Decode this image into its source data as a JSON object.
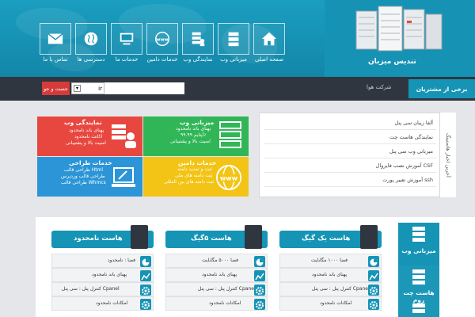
{
  "header": {
    "logo_text": "تندیس میزبان",
    "nav": [
      {
        "label": "صفحه اصلی",
        "icon": "home-icon"
      },
      {
        "label": "میزبانی وب",
        "icon": "server-icon"
      },
      {
        "label": "نمایندگی وب",
        "icon": "servers-user-icon"
      },
      {
        "label": "خدمات دامین",
        "icon": "www-globe-icon"
      },
      {
        "label": "خدمات ما",
        "icon": "monitor-icon"
      },
      {
        "label": "دسترسی ها",
        "icon": "globe-icon"
      },
      {
        "label": "تماس با ما",
        "icon": "mail-icon"
      }
    ]
  },
  "toolbar": {
    "login_label": "برخی از مشتریان",
    "company_label": "شرکت هوا",
    "search_placeholder": "",
    "domain_value": "ir",
    "search_button": "جست و جو"
  },
  "services": {
    "reseller": {
      "title": "نمایندگی وب",
      "lines": [
        "پهنای باند نامحدود",
        "اکانت نامحدود",
        "امنیت بالا و پشتیبانی"
      ]
    },
    "hosting": {
      "title": "میزبانی وب",
      "lines": [
        "پهنای باند نامحدود",
        "آپتایم ۹۹.۹۹٪",
        "امنیت بالا و پشتیبانی"
      ]
    },
    "design": {
      "title": "خدمات طراحی",
      "lines": [
        "طراحی قالب Html",
        "طراحی قالب وردپرس",
        "طراحی قالب Whmcs"
      ]
    },
    "domain": {
      "title": "خدمات دامین",
      "lines": [
        "ثبت و تمدید دامنه",
        "ثبت دامنه های ملی",
        "ثبت دامنه های بین المللی"
      ]
    }
  },
  "news": {
    "side_title": "آخرین اخبار هاستینگ",
    "items": [
      "آلفا زیبان سی پنل",
      "نمایندگی هاست چت",
      "میزبانی وب سی پنل",
      "آموزش نصب فایروال CSF",
      "آموزش تغییر پورت ssh"
    ]
  },
  "hosting": {
    "nav": [
      "میزبانی وب",
      "هاست چت روم"
    ],
    "plans": [
      {
        "title": "هاست یک گیگ",
        "features": [
          "فضا ۱۰۰۰ مگابایت",
          "پهنای باند نامحدود",
          "کنترل پنل : سی پنل Cpanel",
          "امکانات نامحدود"
        ]
      },
      {
        "title": "هاست ۵گیگ",
        "features": [
          "فضا ۵۰۰۰ مگابایت",
          "پهنای باند نامحدود",
          "کنترل پنل : سی پنل Cpanel",
          "امکانات نامحدود"
        ]
      },
      {
        "title": "هاست نامحدود",
        "features": [
          "فضا : نامحدود",
          "پهنای باند نامحدود",
          "کنترل پنل : سی پنل Cpanel",
          "امکانات نامحدود"
        ]
      }
    ]
  },
  "colors": {
    "primary": "#1594b6",
    "dark": "#2f3640",
    "red": "#e8473f",
    "green": "#31b657",
    "blue": "#2c95d7",
    "yellow": "#f3c415"
  }
}
